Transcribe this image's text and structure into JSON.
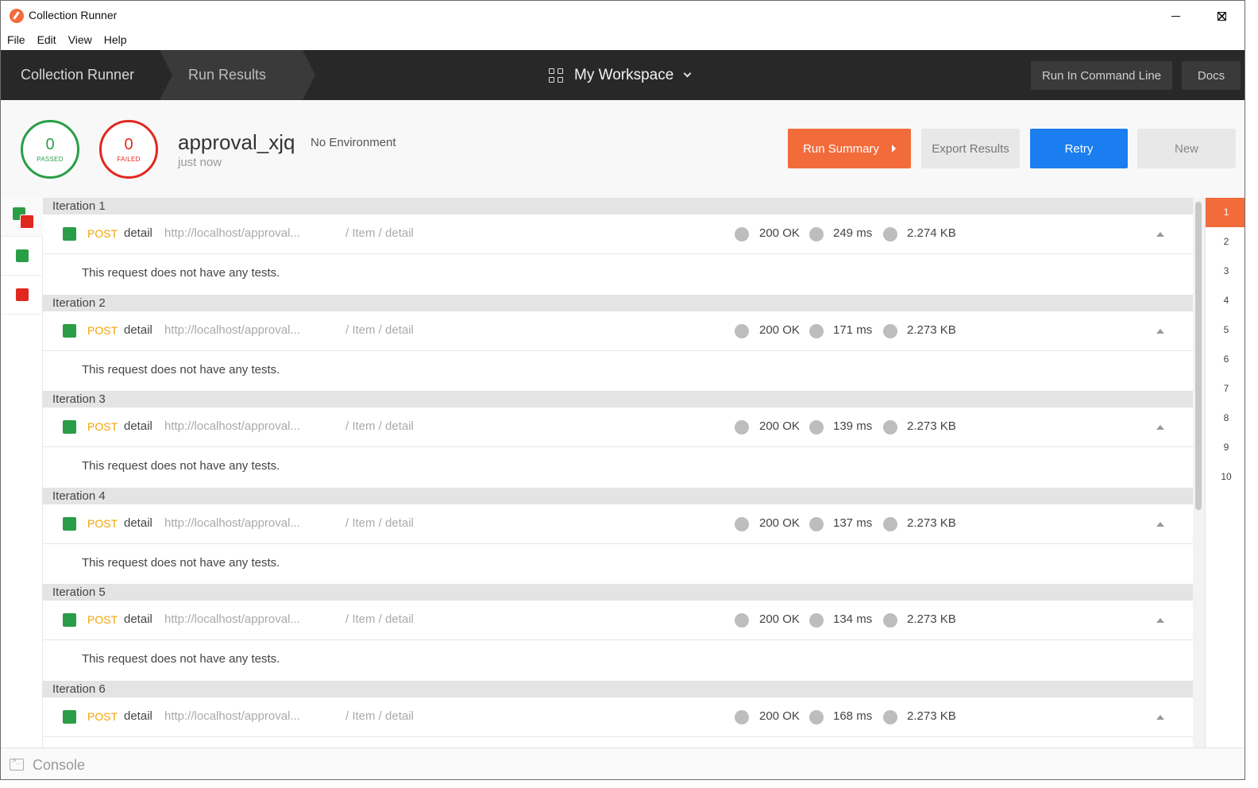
{
  "window": {
    "title": "Collection Runner"
  },
  "menu": {
    "items": [
      "File",
      "Edit",
      "View",
      "Help"
    ]
  },
  "header": {
    "crumbs": [
      "Collection Runner",
      "Run Results"
    ],
    "workspace": "My Workspace",
    "cli_button": "Run In Command Line",
    "docs_button": "Docs"
  },
  "summary": {
    "passed_count": "0",
    "passed_label": "PASSED",
    "failed_count": "0",
    "failed_label": "FAILED",
    "collection_name": "approval_xjq",
    "environment": "No Environment",
    "run_time": "just now",
    "run_summary_button": "Run Summary",
    "export_button": "Export Results",
    "retry_button": "Retry",
    "new_button": "New"
  },
  "colors": {
    "passed": "#2a9d47",
    "failed": "#e0281f",
    "accent": "#f26b3a",
    "primary": "#1a7ef0",
    "method_post": "#f4a300"
  },
  "iterations": [
    {
      "title": "Iteration 1",
      "method": "POST",
      "name": "detail",
      "url": "http://localhost/approval...",
      "path": "/ Item / detail",
      "status": "200 OK",
      "time": "249 ms",
      "size": "2.274 KB",
      "tests_message": "This request does not have any tests."
    },
    {
      "title": "Iteration 2",
      "method": "POST",
      "name": "detail",
      "url": "http://localhost/approval...",
      "path": "/ Item / detail",
      "status": "200 OK",
      "time": "171 ms",
      "size": "2.273 KB",
      "tests_message": "This request does not have any tests."
    },
    {
      "title": "Iteration 3",
      "method": "POST",
      "name": "detail",
      "url": "http://localhost/approval...",
      "path": "/ Item / detail",
      "status": "200 OK",
      "time": "139 ms",
      "size": "2.273 KB",
      "tests_message": "This request does not have any tests."
    },
    {
      "title": "Iteration 4",
      "method": "POST",
      "name": "detail",
      "url": "http://localhost/approval...",
      "path": "/ Item / detail",
      "status": "200 OK",
      "time": "137 ms",
      "size": "2.273 KB",
      "tests_message": "This request does not have any tests."
    },
    {
      "title": "Iteration 5",
      "method": "POST",
      "name": "detail",
      "url": "http://localhost/approval...",
      "path": "/ Item / detail",
      "status": "200 OK",
      "time": "134 ms",
      "size": "2.273 KB",
      "tests_message": "This request does not have any tests."
    },
    {
      "title": "Iteration 6",
      "method": "POST",
      "name": "detail",
      "url": "http://localhost/approval...",
      "path": "/ Item / detail",
      "status": "200 OK",
      "time": "168 ms",
      "size": "2.273 KB",
      "tests_message": "This request does not have any tests."
    }
  ],
  "iteration_nav": {
    "numbers": [
      "1",
      "2",
      "3",
      "4",
      "5",
      "6",
      "7",
      "8",
      "9",
      "10"
    ],
    "active": "1"
  },
  "console": {
    "label": "Console"
  }
}
